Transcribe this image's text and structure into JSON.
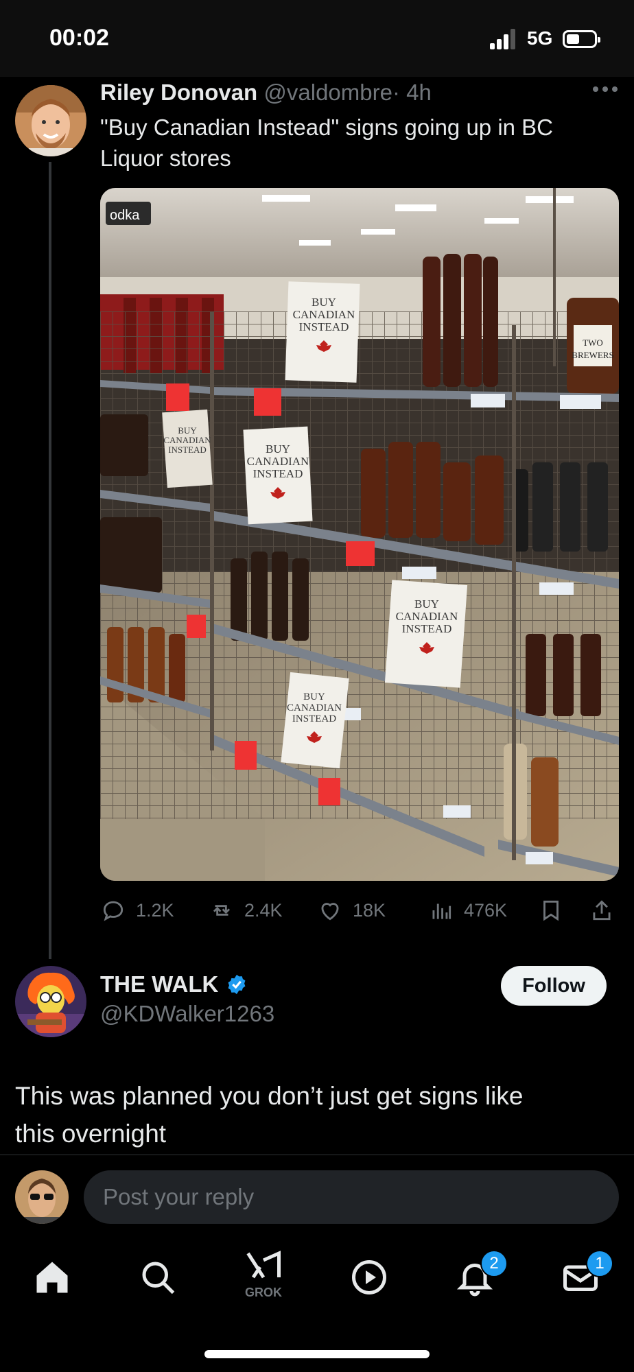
{
  "status_bar": {
    "time": "00:02",
    "network": "5G"
  },
  "tweet": {
    "author_name": "Riley Donovan",
    "author_handle": "@valdombre",
    "time_ago": "· 4h",
    "text_lines": [
      "\"Buy Canadian Instead\" signs going up in BC",
      "Liquor stores"
    ],
    "photo_signs": [
      "BUY",
      "CANADIAN",
      "INSTEAD"
    ],
    "photo_labels": {
      "vodka": "odka",
      "two_brewers": [
        "TWO",
        "BREWERS"
      ]
    },
    "stats": {
      "replies": "1.2K",
      "reposts": "2.4K",
      "likes": "18K",
      "views": "476K"
    }
  },
  "reply": {
    "author_name": "THE WALK",
    "author_handle": "@KDWalker1263",
    "follow_label": "Follow",
    "text_lines": [
      "This was planned you don’t just get signs like",
      "this overnight"
    ]
  },
  "composer": {
    "placeholder": "Post your reply"
  },
  "tab_bar": {
    "grok_label": "GROK",
    "notifications_badge": "2",
    "messages_badge": "1"
  },
  "colors": {
    "accent": "#1d9bf0",
    "background": "#000000",
    "secondary_text": "#71767b"
  }
}
